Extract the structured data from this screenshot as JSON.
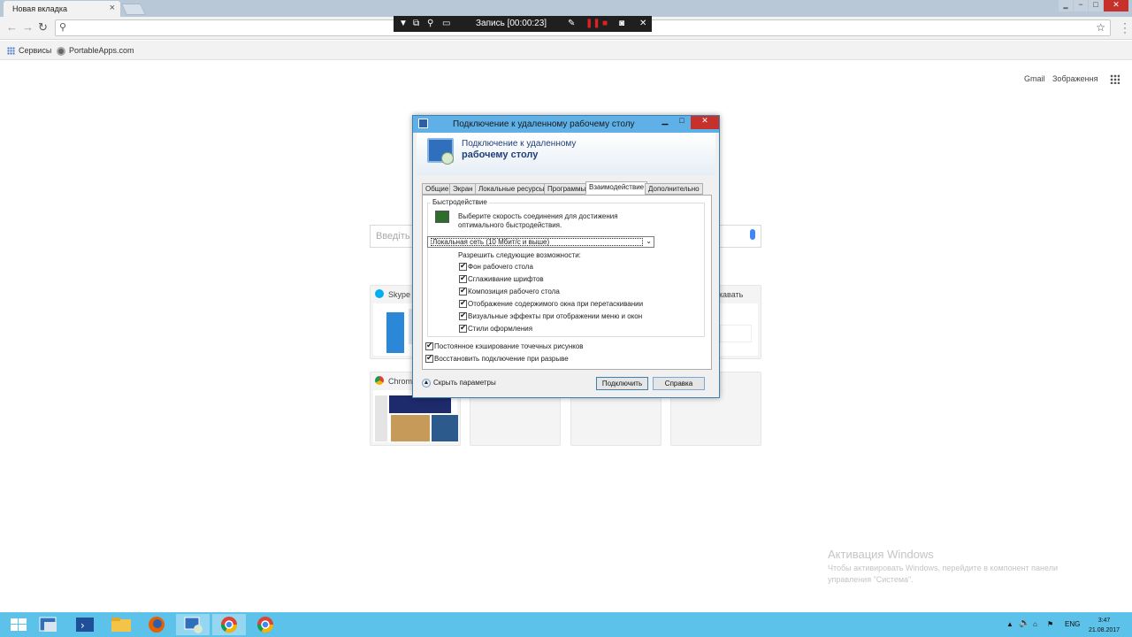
{
  "browser": {
    "tab_title": "Новая вкладка",
    "tab_close": "×",
    "window_controls": [
      "‗",
      "−",
      "□",
      "✕"
    ],
    "bookmarks": [
      "Сервисы",
      "PortableApps.com"
    ]
  },
  "recorder": {
    "status": "Запись [00:00:23]"
  },
  "ntp": {
    "links": [
      "Gmail",
      "Зображення"
    ],
    "search_placeholder": "Введіть",
    "tiles": [
      {
        "label": "Skype |"
      },
      {
        "label": "жавать"
      },
      {
        "label": "Chrome"
      }
    ]
  },
  "dialog": {
    "title": "Подключение к удаленному рабочему столу",
    "header_line1": "Подключение к удаленному",
    "header_line2": "рабочему столу",
    "tabs": [
      "Общие",
      "Экран",
      "Локальные ресурсы",
      "Программы",
      "Взаимодействие",
      "Дополнительно"
    ],
    "active_tab": "Взаимодействие",
    "group_label": "Быстродействие",
    "perf_text": "Выберите скорость соединения для достижения оптимального быстродействия.",
    "speed_select": "Локальная сеть (10 Мбит/с и выше)",
    "allow_label": "Разрешить следующие возможности:",
    "features": [
      "Фон рабочего стола",
      "Сглаживание шрифтов",
      "Композиция рабочего стола",
      "Отображение содержимого окна при перетаскивании",
      "Визуальные эффекты при отображении меню и окон",
      "Стили оформления"
    ],
    "bitmap_cache": "Постоянное кэширование точечных рисунков",
    "reconnect": "Восстановить подключение при разрыве",
    "hide_options": "Скрыть параметры",
    "connect": "Подключить",
    "help": "Справка"
  },
  "watermark": {
    "title": "Активация Windows",
    "text": "Чтобы активировать Windows, перейдите в компонент панели управления \"Система\"."
  },
  "taskbar": {
    "lang": "ENG",
    "time": "3:47",
    "date": "21.08.2017"
  }
}
